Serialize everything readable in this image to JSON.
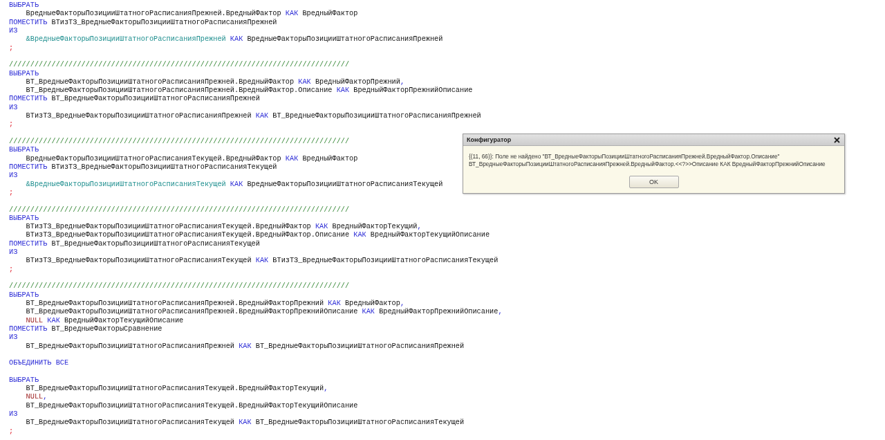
{
  "editor": {
    "lines": [
      {
        "kind": "code",
        "tokens": [
          {
            "kind": "kw",
            "text": "ВЫБРАТЬ"
          }
        ]
      },
      {
        "kind": "code",
        "tokens": [
          {
            "kind": "id",
            "text": "    ВредныеФакторыПозицииШтатногоРасписанияПрежней.ВредныйФактор "
          },
          {
            "kind": "kw",
            "text": "КАК"
          },
          {
            "kind": "id",
            "text": " ВредныйФактор"
          }
        ]
      },
      {
        "kind": "code",
        "tokens": [
          {
            "kind": "kw",
            "text": "ПОМЕСТИТЬ"
          },
          {
            "kind": "id",
            "text": " ВТизТЗ_ВредныеФакторыПозицииШтатногоРасписанияПрежней"
          }
        ]
      },
      {
        "kind": "code",
        "tokens": [
          {
            "kind": "kw",
            "text": "ИЗ"
          }
        ]
      },
      {
        "kind": "code",
        "indented": true,
        "tokens": [
          {
            "kind": "param",
            "text": "&ВредныеФакторыПозицииШтатногоРасписанияПрежней"
          },
          {
            "kind": "kw",
            "text": " КАК"
          },
          {
            "kind": "id",
            "text": " ВредныеФакторыПозицииШтатногоРасписанияПрежней"
          }
        ]
      },
      {
        "kind": "code",
        "tokens": [
          {
            "kind": "punct",
            "text": ";"
          }
        ]
      },
      {
        "kind": "blank"
      },
      {
        "kind": "code",
        "tokens": [
          {
            "kind": "comment",
            "text": "////////////////////////////////////////////////////////////////////////////////"
          }
        ]
      },
      {
        "kind": "code",
        "tokens": [
          {
            "kind": "kw",
            "text": "ВЫБРАТЬ"
          }
        ]
      },
      {
        "kind": "code",
        "tokens": [
          {
            "kind": "id",
            "text": "    ВТ_ВредныеФакторыПозицииШтатногоРасписанияПрежней.ВредныйФактор "
          },
          {
            "kind": "kw",
            "text": "КАК"
          },
          {
            "kind": "id",
            "text": " ВредныйФакторПрежний"
          },
          {
            "kind": "op",
            "text": ","
          }
        ]
      },
      {
        "kind": "code",
        "tokens": [
          {
            "kind": "id",
            "text": "    ВТ_ВредныеФакторыПозицииШтатногоРасписанияПрежней.ВредныйФактор.Описание "
          },
          {
            "kind": "kw",
            "text": "КАК"
          },
          {
            "kind": "id",
            "text": " ВредныйФакторПрежнийОписание"
          }
        ]
      },
      {
        "kind": "code",
        "tokens": [
          {
            "kind": "kw",
            "text": "ПОМЕСТИТЬ"
          },
          {
            "kind": "id",
            "text": " ВТ_ВредныеФакторыПозицииШтатногоРасписанияПрежней"
          }
        ]
      },
      {
        "kind": "code",
        "tokens": [
          {
            "kind": "kw",
            "text": "ИЗ"
          }
        ]
      },
      {
        "kind": "code",
        "tokens": [
          {
            "kind": "id",
            "text": "    ВТизТЗ_ВредныеФакторыПозицииШтатногоРасписанияПрежней "
          },
          {
            "kind": "kw",
            "text": "КАК"
          },
          {
            "kind": "id",
            "text": " ВТ_ВредныеФакторыПозицииШтатногоРасписанияПрежней"
          }
        ]
      },
      {
        "kind": "code",
        "tokens": [
          {
            "kind": "punct",
            "text": ";"
          }
        ]
      },
      {
        "kind": "blank"
      },
      {
        "kind": "code",
        "tokens": [
          {
            "kind": "comment",
            "text": "////////////////////////////////////////////////////////////////////////////////"
          }
        ]
      },
      {
        "kind": "code",
        "tokens": [
          {
            "kind": "kw",
            "text": "ВЫБРАТЬ"
          }
        ]
      },
      {
        "kind": "code",
        "tokens": [
          {
            "kind": "id",
            "text": "    ВредныеФакторыПозицииШтатногоРасписанияТекущей.ВредныйФактор "
          },
          {
            "kind": "kw",
            "text": "КАК"
          },
          {
            "kind": "id",
            "text": " ВредныйФактор"
          }
        ]
      },
      {
        "kind": "code",
        "tokens": [
          {
            "kind": "kw",
            "text": "ПОМЕСТИТЬ"
          },
          {
            "kind": "id",
            "text": " ВТизТЗ_ВредныеФакторыПозицииШтатногоРасписанияТекущей"
          }
        ]
      },
      {
        "kind": "code",
        "tokens": [
          {
            "kind": "kw",
            "text": "ИЗ"
          }
        ]
      },
      {
        "kind": "code",
        "indented": true,
        "tokens": [
          {
            "kind": "param",
            "text": "&ВредныеФакторыПозицииШтатногоРасписанияТекущей"
          },
          {
            "kind": "kw",
            "text": " КАК"
          },
          {
            "kind": "id",
            "text": " ВредныеФакторыПозицииШтатногоРасписанияТекущей"
          }
        ]
      },
      {
        "kind": "code",
        "tokens": [
          {
            "kind": "punct",
            "text": ";"
          }
        ]
      },
      {
        "kind": "blank"
      },
      {
        "kind": "code",
        "tokens": [
          {
            "kind": "comment",
            "text": "////////////////////////////////////////////////////////////////////////////////"
          }
        ]
      },
      {
        "kind": "code",
        "tokens": [
          {
            "kind": "kw",
            "text": "ВЫБРАТЬ"
          }
        ]
      },
      {
        "kind": "code",
        "tokens": [
          {
            "kind": "id",
            "text": "    ВТизТЗ_ВредныеФакторыПозицииШтатногоРасписанияТекущей.ВредныйФактор "
          },
          {
            "kind": "kw",
            "text": "КАК"
          },
          {
            "kind": "id",
            "text": " ВредныйФакторТекущий"
          },
          {
            "kind": "op",
            "text": ","
          }
        ]
      },
      {
        "kind": "code",
        "tokens": [
          {
            "kind": "id",
            "text": "    ВТизТЗ_ВредныеФакторыПозицииШтатногоРасписанияТекущей.ВредныйФактор.Описание "
          },
          {
            "kind": "kw",
            "text": "КАК"
          },
          {
            "kind": "id",
            "text": " ВредныйФакторТекущийОписание"
          }
        ]
      },
      {
        "kind": "code",
        "tokens": [
          {
            "kind": "kw",
            "text": "ПОМЕСТИТЬ"
          },
          {
            "kind": "id",
            "text": " ВТ_ВредныеФакторыПозицииШтатногоРасписанияТекущей"
          }
        ]
      },
      {
        "kind": "code",
        "tokens": [
          {
            "kind": "kw",
            "text": "ИЗ"
          }
        ]
      },
      {
        "kind": "code",
        "tokens": [
          {
            "kind": "id",
            "text": "    ВТизТЗ_ВредныеФакторыПозицииШтатногоРасписанияТекущей "
          },
          {
            "kind": "kw",
            "text": "КАК"
          },
          {
            "kind": "id",
            "text": " ВТизТЗ_ВредныеФакторыПозицииШтатногоРасписанияТекущей"
          }
        ]
      },
      {
        "kind": "code",
        "tokens": [
          {
            "kind": "punct",
            "text": ";"
          }
        ]
      },
      {
        "kind": "blank"
      },
      {
        "kind": "code",
        "tokens": [
          {
            "kind": "comment",
            "text": "////////////////////////////////////////////////////////////////////////////////"
          }
        ]
      },
      {
        "kind": "code",
        "tokens": [
          {
            "kind": "kw",
            "text": "ВЫБРАТЬ"
          }
        ]
      },
      {
        "kind": "code",
        "tokens": [
          {
            "kind": "id",
            "text": "    ВТ_ВредныеФакторыПозицииШтатногоРасписанияПрежней.ВредныйФакторПрежний "
          },
          {
            "kind": "kw",
            "text": "КАК"
          },
          {
            "kind": "id",
            "text": " ВредныйФактор"
          },
          {
            "kind": "op",
            "text": ","
          }
        ]
      },
      {
        "kind": "code",
        "tokens": [
          {
            "kind": "id",
            "text": "    ВТ_ВредныеФакторыПозицииШтатногоРасписанияПрежней.ВредныйФакторПрежнийОписание "
          },
          {
            "kind": "kw",
            "text": "КАК"
          },
          {
            "kind": "id",
            "text": " ВредныйФакторПрежнийОписание"
          },
          {
            "kind": "op",
            "text": ","
          }
        ]
      },
      {
        "kind": "code",
        "indented": true,
        "tokens": [
          {
            "kind": "null",
            "text": "NULL"
          },
          {
            "kind": "kw",
            "text": " КАК"
          },
          {
            "kind": "id",
            "text": " ВредныйФакторТекущийОписание"
          }
        ]
      },
      {
        "kind": "code",
        "tokens": [
          {
            "kind": "kw",
            "text": "ПОМЕСТИТЬ"
          },
          {
            "kind": "id",
            "text": " ВТ_ВредныеФакторыСравнение"
          }
        ]
      },
      {
        "kind": "code",
        "tokens": [
          {
            "kind": "kw",
            "text": "ИЗ"
          }
        ]
      },
      {
        "kind": "code",
        "tokens": [
          {
            "kind": "id",
            "text": "    ВТ_ВредныеФакторыПозицииШтатногоРасписанияПрежней "
          },
          {
            "kind": "kw",
            "text": "КАК"
          },
          {
            "kind": "id",
            "text": " ВТ_ВредныеФакторыПозицииШтатногоРасписанияПрежней"
          }
        ]
      },
      {
        "kind": "blank"
      },
      {
        "kind": "code",
        "tokens": [
          {
            "kind": "kw",
            "text": "ОБЪЕДИНИТЬ ВСЕ"
          }
        ]
      },
      {
        "kind": "blank"
      },
      {
        "kind": "code",
        "tokens": [
          {
            "kind": "kw",
            "text": "ВЫБРАТЬ"
          }
        ]
      },
      {
        "kind": "code",
        "tokens": [
          {
            "kind": "id",
            "text": "    ВТ_ВредныеФакторыПозицииШтатногоРасписанияТекущей.ВредныйФакторТекущий"
          },
          {
            "kind": "op",
            "text": ","
          }
        ]
      },
      {
        "kind": "code",
        "indented": true,
        "tokens": [
          {
            "kind": "null",
            "text": "NULL"
          },
          {
            "kind": "op",
            "text": ","
          }
        ]
      },
      {
        "kind": "code",
        "tokens": [
          {
            "kind": "id",
            "text": "    ВТ_ВредныеФакторыПозицииШтатногоРасписанияТекущей.ВредныйФакторТекущийОписание"
          }
        ]
      },
      {
        "kind": "code",
        "tokens": [
          {
            "kind": "kw",
            "text": "ИЗ"
          }
        ]
      },
      {
        "kind": "code",
        "tokens": [
          {
            "kind": "id",
            "text": "    ВТ_ВредныеФакторыПозицииШтатногоРасписанияТекущей "
          },
          {
            "kind": "kw",
            "text": "КАК"
          },
          {
            "kind": "id",
            "text": " ВТ_ВредныеФакторыПозицииШтатногоРасписанияТекущей"
          }
        ]
      },
      {
        "kind": "code",
        "tokens": [
          {
            "kind": "punct",
            "text": ";"
          }
        ]
      }
    ]
  },
  "dialog": {
    "title": "Конфигуратор",
    "message_lines": [
      "{(11, 66)}: Поле не найдено \"ВТ_ВредныеФакторыПозицииШтатногоРасписанияПрежней.ВредныйФактор.Описание\"",
      "ВТ_ВредныеФакторыПозицииШтатногоРасписанияПрежней.ВредныйФактор.<<?>>Описание КАК ВредныйФакторПрежнийОписание"
    ],
    "button": "OK"
  }
}
